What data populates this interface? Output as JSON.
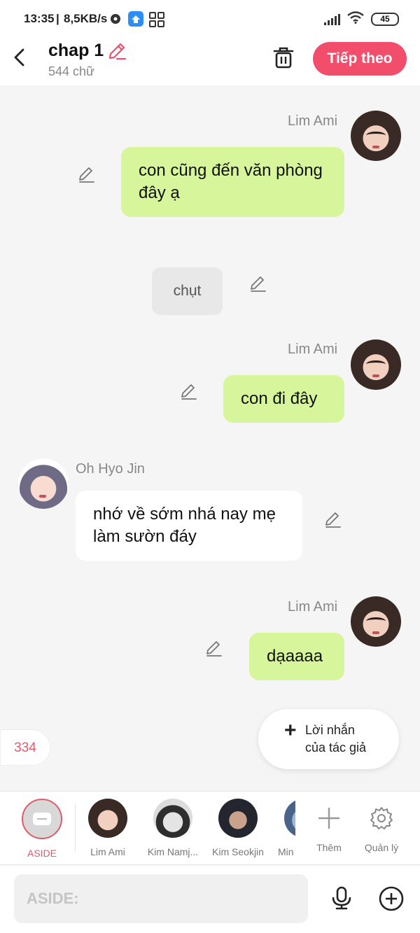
{
  "status_bar": {
    "time": "13:35",
    "network_speed": "8,5KB/s",
    "battery": "45"
  },
  "header": {
    "title": "chap 1",
    "word_count": "544 chữ",
    "next_button": "Tiếp theo"
  },
  "messages": [
    {
      "type": "right",
      "sender": "Lim Ami",
      "text": "con cũng đến văn phòng đây ạ"
    },
    {
      "type": "center",
      "text": "chụt"
    },
    {
      "type": "right",
      "sender": "Lim Ami",
      "text": "con đi đây"
    },
    {
      "type": "left",
      "sender": "Oh Hyo Jin",
      "text": "nhớ về sớm nhá nay mẹ làm sườn đáy"
    },
    {
      "type": "right",
      "sender": "Lim Ami",
      "text": "dạaaaa"
    }
  ],
  "floating": {
    "count": "334",
    "author_note_line1": "Lời nhắn",
    "author_note_line2": "của tác giả"
  },
  "characters": [
    {
      "name": "ASIDE",
      "selected": true
    },
    {
      "name": "Lim Ami"
    },
    {
      "name": "Kim Namj..."
    },
    {
      "name": "Kim Seokjin"
    },
    {
      "name": "Min"
    }
  ],
  "actions": {
    "add": "Thêm",
    "manage": "Quản lý"
  },
  "composer": {
    "placeholder": "ASIDE:"
  },
  "colors": {
    "accent": "#f24d6b",
    "bubble_green": "#d7f59a"
  }
}
